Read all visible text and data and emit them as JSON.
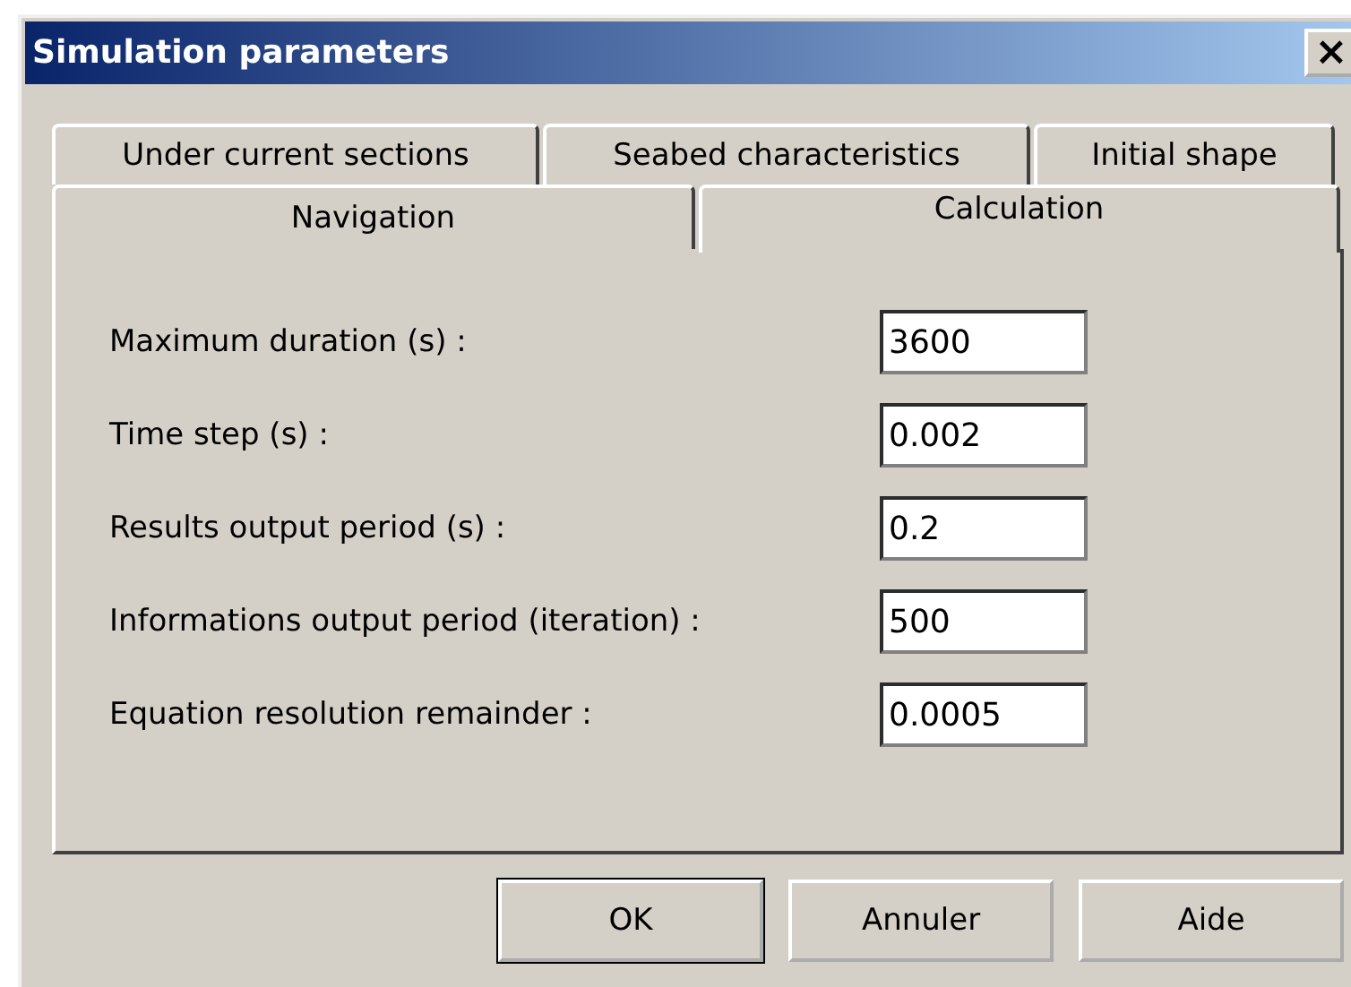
{
  "window": {
    "title": "Simulation parameters",
    "close": "×"
  },
  "tab_rows": [
    [
      {
        "label": "Under current sections",
        "selected": false
      },
      {
        "label": "Seabed characteristics",
        "selected": false
      },
      {
        "label": "Initial shape",
        "selected": false
      }
    ],
    [
      {
        "label": "Navigation",
        "selected": false
      },
      {
        "label": "Calculation",
        "selected": true
      }
    ]
  ],
  "fields": [
    {
      "label": "Maximum duration (s) :",
      "value": "3600"
    },
    {
      "label": "Time step (s) :",
      "value": "0.002"
    },
    {
      "label": "Results output period (s) :",
      "value": "0.2"
    },
    {
      "label": "Informations output period (iteration)  :",
      "value": "500"
    },
    {
      "label": "Equation resolution remainder :",
      "value": "0.0005"
    }
  ],
  "buttons": [
    {
      "label": "OK",
      "default": true
    },
    {
      "label": "Annuler",
      "default": false
    },
    {
      "label": "Aide",
      "default": false
    }
  ]
}
